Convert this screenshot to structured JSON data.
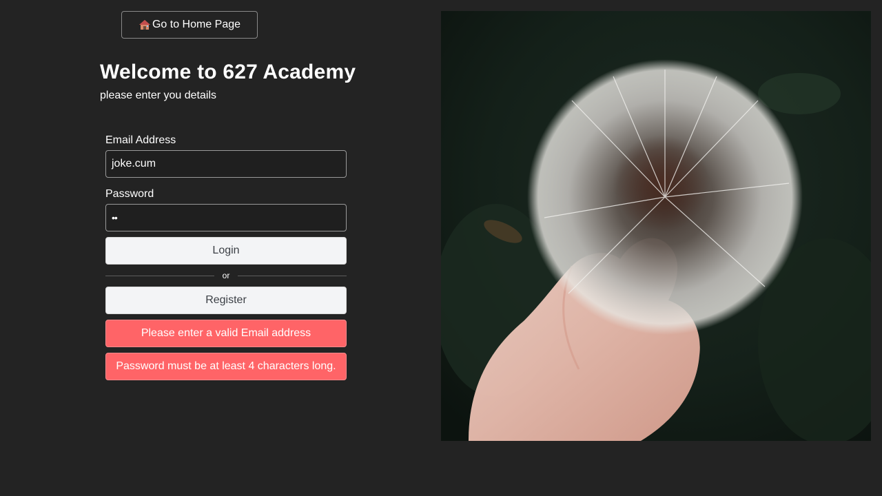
{
  "home_button": {
    "icon": "house-icon",
    "label": "Go to Home Page"
  },
  "header": {
    "title": "Welcome to 627 Academy",
    "subtitle": "please enter you details"
  },
  "form": {
    "email_label": "Email Address",
    "email_value": "joke.cum",
    "password_label": "Password",
    "password_value": "••",
    "login_label": "Login",
    "divider_text": "or",
    "register_label": "Register"
  },
  "errors": [
    "Please enter a valid Email address",
    "Password must be at least 4 characters long."
  ],
  "colors": {
    "background": "#232323",
    "error": "#ff6467",
    "button_light": "#f3f4f6"
  },
  "hero_image": {
    "subject": "hand holding dandelion"
  }
}
